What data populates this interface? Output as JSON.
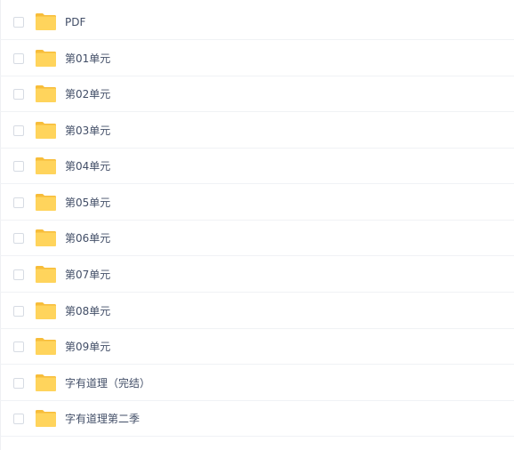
{
  "file_list": {
    "items": [
      {
        "name": "PDF",
        "type": "folder"
      },
      {
        "name": "第01单元",
        "type": "folder"
      },
      {
        "name": "第02单元",
        "type": "folder"
      },
      {
        "name": "第03单元",
        "type": "folder"
      },
      {
        "name": "第04单元",
        "type": "folder"
      },
      {
        "name": "第05单元",
        "type": "folder"
      },
      {
        "name": "第06单元",
        "type": "folder"
      },
      {
        "name": "第07单元",
        "type": "folder"
      },
      {
        "name": "第08单元",
        "type": "folder"
      },
      {
        "name": "第09单元",
        "type": "folder"
      },
      {
        "name": "字有道理（完结）",
        "type": "folder"
      },
      {
        "name": "字有道理第二季",
        "type": "folder"
      }
    ]
  },
  "colors": {
    "folder_body": "#ffd45c",
    "folder_tab": "#f7bd3a",
    "text": "#424e67",
    "divider": "#f0f2f5"
  },
  "icons": {
    "folder": "folder-icon",
    "checkbox": "checkbox-icon"
  }
}
